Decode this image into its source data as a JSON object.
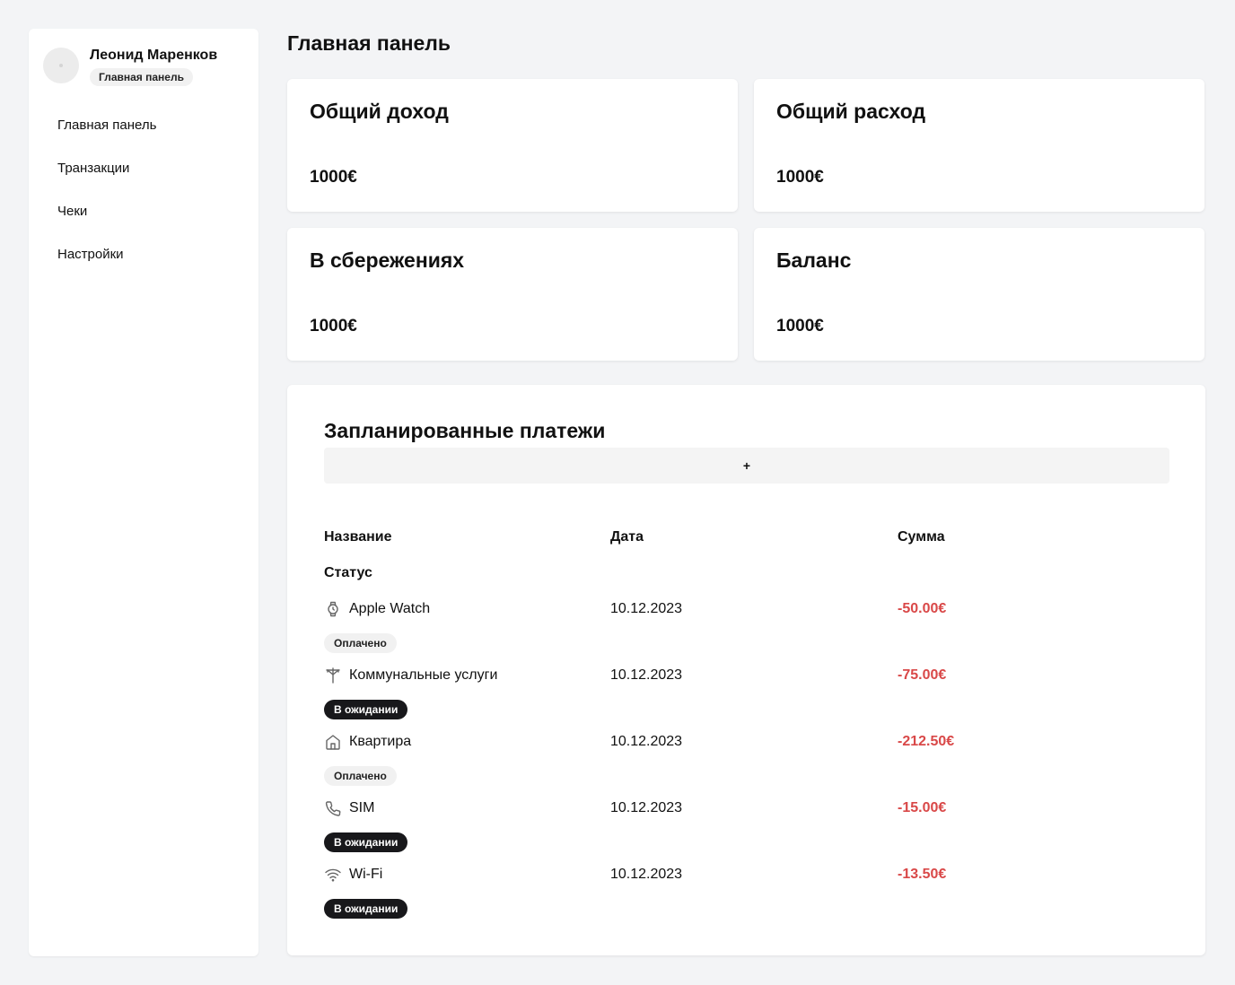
{
  "sidebar": {
    "user_name": "Леонид Маренков",
    "role": "Главная панель",
    "nav": [
      {
        "label": "Главная панель"
      },
      {
        "label": "Транзакции"
      },
      {
        "label": "Чеки"
      },
      {
        "label": "Настройки"
      }
    ]
  },
  "header": {
    "title": "Главная панель"
  },
  "cards": [
    {
      "title": "Общий доход",
      "value": "1000€"
    },
    {
      "title": "Общий расход",
      "value": "1000€"
    },
    {
      "title": "В сбережениях",
      "value": "1000€"
    },
    {
      "title": "Баланс",
      "value": "1000€"
    }
  ],
  "payments": {
    "title": "Запланированные платежи",
    "add_label": "+",
    "columns": {
      "name": "Название",
      "date": "Дата",
      "amount": "Сумма",
      "status": "Статус"
    },
    "rows": [
      {
        "icon": "watch-icon",
        "name": "Apple Watch",
        "date": "10.12.2023",
        "amount": "-50.00€",
        "status": "Оплачено"
      },
      {
        "icon": "utility-pole-icon",
        "name": "Коммунальные услуги",
        "date": "10.12.2023",
        "amount": "-75.00€",
        "status": "В ожидании"
      },
      {
        "icon": "home-icon",
        "name": "Квартира",
        "date": "10.12.2023",
        "amount": "-212.50€",
        "status": "Оплачено"
      },
      {
        "icon": "phone-icon",
        "name": "SIM",
        "date": "10.12.2023",
        "amount": "-15.00€",
        "status": "В ожидании"
      },
      {
        "icon": "wifi-icon",
        "name": "Wi-Fi",
        "date": "10.12.2023",
        "amount": "-13.50€",
        "status": "В ожидании"
      }
    ]
  },
  "colors": {
    "amount": "#d94848",
    "pending_badge": "#18181b",
    "paid_badge": "#f1f1f1",
    "background": "#f3f4f6"
  }
}
